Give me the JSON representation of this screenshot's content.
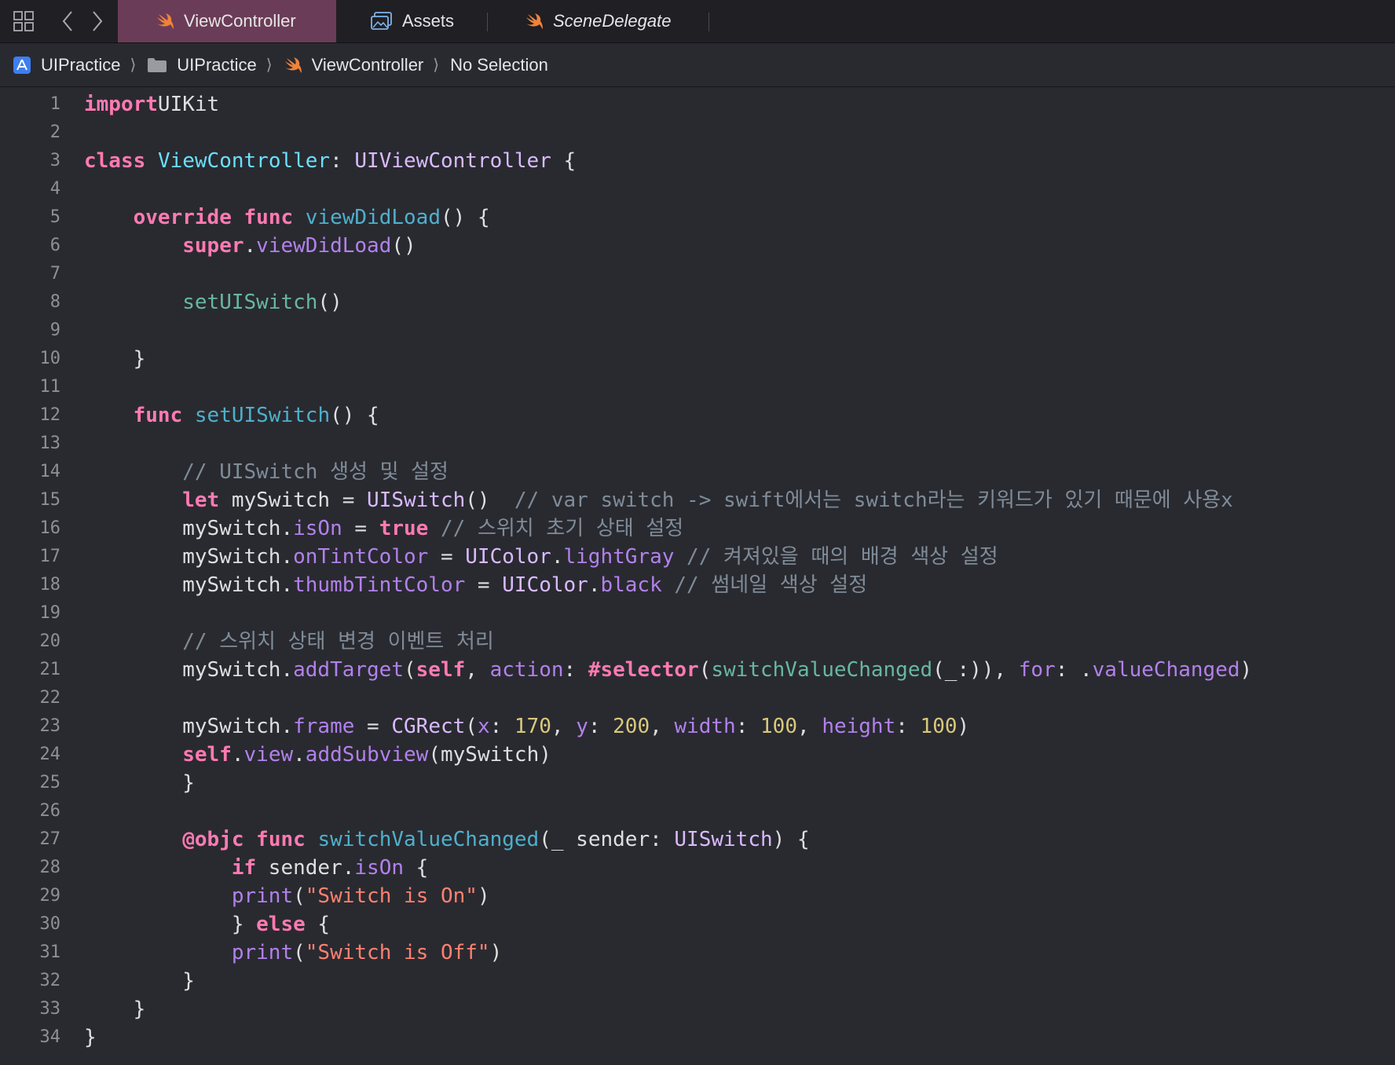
{
  "tabs": [
    {
      "label": "ViewController",
      "icon": "swift-icon",
      "active": true
    },
    {
      "label": "Assets",
      "icon": "assets-icon",
      "active": false
    },
    {
      "label": "SceneDelegate",
      "icon": "swift-icon",
      "active": false
    }
  ],
  "breadcrumb": {
    "project": "UIPractice",
    "folder": "UIPractice",
    "file": "ViewController",
    "selection": "No Selection"
  },
  "colors": {
    "editor_bg": "#292a30",
    "keyword": "#ff7ab2",
    "type_decl": "#6bdfff",
    "func_decl": "#4eb0cc",
    "project_func": "#67b7a4",
    "system_api": "#b281eb",
    "comment": "#7f8c98",
    "string": "#ff8170",
    "number": "#d9c97c",
    "active_tab": "#6b3c57"
  },
  "code": {
    "lines": [
      [
        [
          "kw",
          "import"
        ],
        [
          "",
          "UIKit"
        ]
      ],
      [],
      [
        [
          "kw",
          "class"
        ],
        [
          "",
          ""
        ],
        [
          "tdecl",
          "ViewController"
        ],
        [
          "",
          ": "
        ],
        [
          "sysb",
          "UIViewController"
        ],
        [
          "",
          " {"
        ]
      ],
      [],
      [
        [
          "",
          "    "
        ],
        [
          "kw",
          "override"
        ],
        [
          "",
          " "
        ],
        [
          "kw",
          "func"
        ],
        [
          "",
          " "
        ],
        [
          "fdecl",
          "viewDidLoad"
        ],
        [
          "",
          "() {"
        ]
      ],
      [
        [
          "",
          "        "
        ],
        [
          "kw",
          "super"
        ],
        [
          "",
          "."
        ],
        [
          "sys",
          "viewDidLoad"
        ],
        [
          "",
          "()"
        ]
      ],
      [],
      [
        [
          "",
          "        "
        ],
        [
          "fcall",
          "setUISwitch"
        ],
        [
          "",
          "()"
        ]
      ],
      [],
      [
        [
          "",
          "    }"
        ]
      ],
      [],
      [
        [
          "",
          "    "
        ],
        [
          "kw",
          "func"
        ],
        [
          "",
          " "
        ],
        [
          "fdecl",
          "setUISwitch"
        ],
        [
          "",
          "() {"
        ]
      ],
      [],
      [
        [
          "",
          "        "
        ],
        [
          "cmt",
          "// UISwitch 생성 및 설정"
        ]
      ],
      [
        [
          "",
          "        "
        ],
        [
          "kw",
          "let"
        ],
        [
          "",
          " mySwitch = "
        ],
        [
          "sysb",
          "UISwitch"
        ],
        [
          "",
          "()  "
        ],
        [
          "cmt",
          "// var switch -> swift에서는 switch라는 키워드가 있기 때문에 사용x"
        ]
      ],
      [
        [
          "",
          "        mySwitch."
        ],
        [
          "sys",
          "isOn"
        ],
        [
          "",
          " = "
        ],
        [
          "kw",
          "true"
        ],
        [
          "",
          " "
        ],
        [
          "cmt",
          "// 스위치 초기 상태 설정"
        ]
      ],
      [
        [
          "",
          "        mySwitch."
        ],
        [
          "sys",
          "onTintColor"
        ],
        [
          "",
          " = "
        ],
        [
          "sysb",
          "UIColor"
        ],
        [
          "",
          "."
        ],
        [
          "sys",
          "lightGray"
        ],
        [
          "",
          " "
        ],
        [
          "cmt",
          "// 켜져있을 때의 배경 색상 설정"
        ]
      ],
      [
        [
          "",
          "        mySwitch."
        ],
        [
          "sys",
          "thumbTintColor"
        ],
        [
          "",
          " = "
        ],
        [
          "sysb",
          "UIColor"
        ],
        [
          "",
          "."
        ],
        [
          "sys",
          "black"
        ],
        [
          "",
          " "
        ],
        [
          "cmt",
          "// 썸네일 색상 설정"
        ]
      ],
      [],
      [
        [
          "",
          "        "
        ],
        [
          "cmt",
          "// 스위치 상태 변경 이벤트 처리"
        ]
      ],
      [
        [
          "",
          "        mySwitch."
        ],
        [
          "sys",
          "addTarget"
        ],
        [
          "",
          "("
        ],
        [
          "kw",
          "self"
        ],
        [
          "",
          ", "
        ],
        [
          "sys",
          "action"
        ],
        [
          "",
          ": "
        ],
        [
          "kw",
          "#selector"
        ],
        [
          "",
          "("
        ],
        [
          "fcall",
          "switchValueChanged"
        ],
        [
          "",
          "(_:)), "
        ],
        [
          "sys",
          "for"
        ],
        [
          "",
          ": ."
        ],
        [
          "sys",
          "valueChanged"
        ],
        [
          "",
          ")"
        ]
      ],
      [],
      [
        [
          "",
          "        mySwitch."
        ],
        [
          "sys",
          "frame"
        ],
        [
          "",
          " = "
        ],
        [
          "sysb",
          "CGRect"
        ],
        [
          "",
          "("
        ],
        [
          "sys",
          "x"
        ],
        [
          "",
          ": "
        ],
        [
          "num",
          "170"
        ],
        [
          "",
          ", "
        ],
        [
          "sys",
          "y"
        ],
        [
          "",
          ": "
        ],
        [
          "num",
          "200"
        ],
        [
          "",
          ", "
        ],
        [
          "sys",
          "width"
        ],
        [
          "",
          ": "
        ],
        [
          "num",
          "100"
        ],
        [
          "",
          ", "
        ],
        [
          "sys",
          "height"
        ],
        [
          "",
          ": "
        ],
        [
          "num",
          "100"
        ],
        [
          "",
          ")"
        ]
      ],
      [
        [
          "",
          "        "
        ],
        [
          "kw",
          "self"
        ],
        [
          "",
          "."
        ],
        [
          "sys",
          "view"
        ],
        [
          "",
          "."
        ],
        [
          "sys",
          "addSubview"
        ],
        [
          "",
          "(mySwitch)"
        ]
      ],
      [
        [
          "",
          "        }"
        ]
      ],
      [],
      [
        [
          "",
          "        "
        ],
        [
          "attr",
          "@objc"
        ],
        [
          "",
          " "
        ],
        [
          "kw",
          "func"
        ],
        [
          "",
          " "
        ],
        [
          "fdecl",
          "switchValueChanged"
        ],
        [
          "",
          "(_ sender: "
        ],
        [
          "sysb",
          "UISwitch"
        ],
        [
          "",
          ") {"
        ]
      ],
      [
        [
          "",
          "            "
        ],
        [
          "kw",
          "if"
        ],
        [
          "",
          " sender."
        ],
        [
          "sys",
          "isOn"
        ],
        [
          "",
          " {"
        ]
      ],
      [
        [
          "",
          "            "
        ],
        [
          "sys",
          "print"
        ],
        [
          "",
          "("
        ],
        [
          "str",
          "\"Switch is On\""
        ],
        [
          "",
          ")"
        ]
      ],
      [
        [
          "",
          "            } "
        ],
        [
          "kw",
          "else"
        ],
        [
          "",
          " {"
        ]
      ],
      [
        [
          "",
          "            "
        ],
        [
          "sys",
          "print"
        ],
        [
          "",
          "("
        ],
        [
          "str",
          "\"Switch is Off\""
        ],
        [
          "",
          ")"
        ]
      ],
      [
        [
          "",
          "        }"
        ]
      ],
      [
        [
          "",
          "    }"
        ]
      ],
      [
        [
          "",
          "}"
        ]
      ]
    ]
  }
}
